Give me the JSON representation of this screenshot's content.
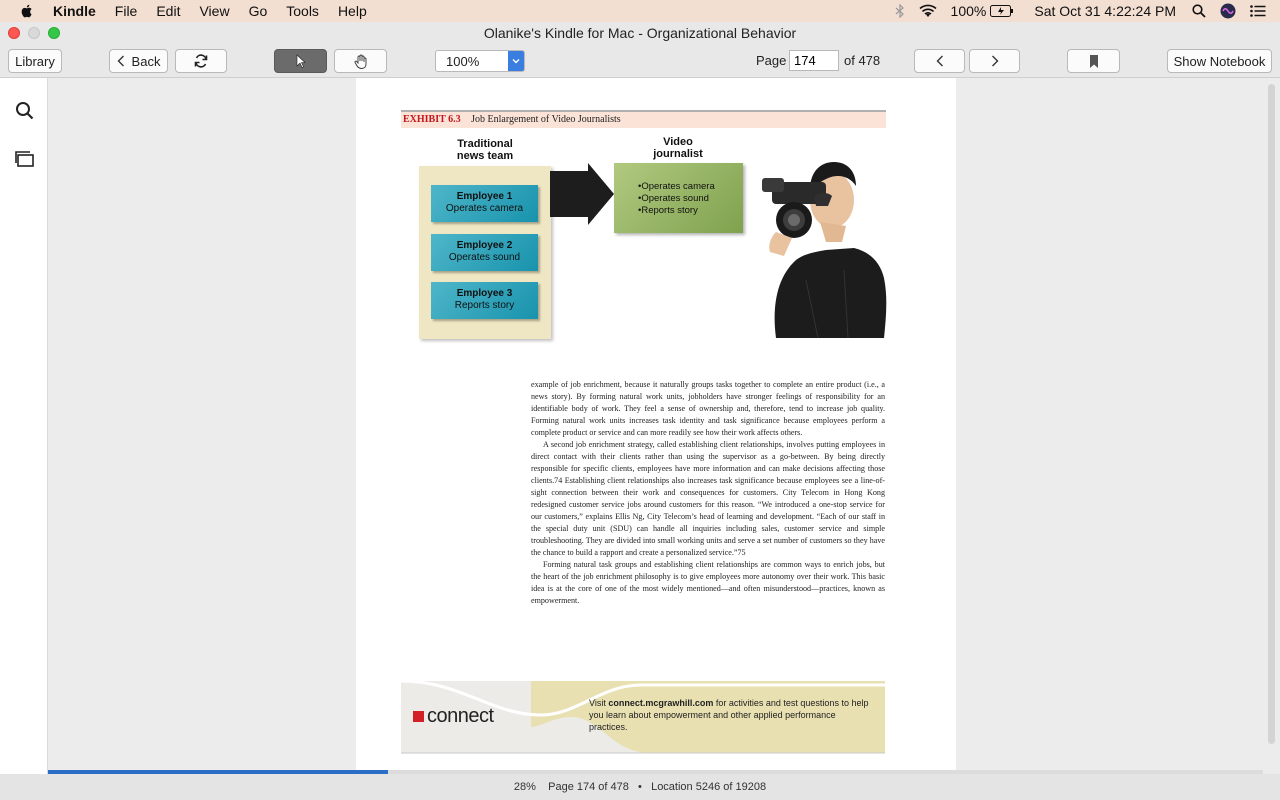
{
  "menubar": {
    "app_name": "Kindle",
    "items": [
      "File",
      "Edit",
      "View",
      "Go",
      "Tools",
      "Help"
    ],
    "battery": "100%",
    "clock": "Sat Oct 31  4:22:24 PM"
  },
  "window": {
    "title": "Olanike's Kindle for Mac - Organizational Behavior"
  },
  "toolbar": {
    "library_label": "Library",
    "back_label": "Back",
    "zoom_value": "100%",
    "page_label": "Page",
    "page_input": "174",
    "page_total": "of 478",
    "notebook_label": "Show Notebook"
  },
  "exhibit": {
    "number": "EXHIBIT 6.3",
    "title": "Job Enlargement of Video Journalists",
    "left_heading": "Traditional news team",
    "right_heading": "Video journalist",
    "employees": [
      {
        "name": "Employee 1",
        "task": "Operates camera"
      },
      {
        "name": "Employee 2",
        "task": "Operates sound"
      },
      {
        "name": "Employee 3",
        "task": "Reports story"
      }
    ],
    "journalist_tasks": [
      "Operates camera",
      "Operates sound",
      "Reports story"
    ]
  },
  "body": {
    "p1": "example of job enrichment, because it naturally groups tasks together to complete an entire product (i.e., a news story). By forming natural work units, jobholders have stronger feelings of responsibility for an identifiable body of work. They feel a sense of ownership and, therefore, tend to increase job quality. Forming natural work units increases task identity and task significance because employees perform a complete product or service and can more readily see how their work affects others.",
    "p2": "A second job enrichment strategy, called establishing client relationships, involves putting employees in direct contact with their clients rather than using the supervisor as a go-between. By being directly responsible for specific clients, employees have more information and can make decisions affecting those clients.74 Establishing client relationships also increases task significance because employees see a line-of-sight connection between their work and consequences for customers. City Telecom in Hong Kong redesigned customer service jobs around customers for this reason. “We introduced a one-stop service for our customers,” explains Ellis Ng, City Telecom’s head of learning and development. “Each of our staff in the special duty unit (SDU) can handle all inquiries including sales, customer service and simple troubleshooting. They are divided into small working units and serve a set number of customers so they have the chance to build a rapport and create a personalized service.”75",
    "p3": "Forming natural task groups and establishing client relationships are common ways to enrich jobs, but the heart of the job enrichment philosophy is to give employees more autonomy over their work. This basic idea is at the core of one of the most widely mentioned—and often misunderstood—practices, known as empowerment."
  },
  "banner": {
    "logo_text": "connect",
    "text_prefix": "Visit ",
    "url": "connect.mcgrawhill.com",
    "text_suffix": " for activities and test questions to help you learn about empowerment and other applied performance practices."
  },
  "status": {
    "progress_percent": 28,
    "text": "28%    Page 174 of 478   •   Location 5246 of 19208"
  },
  "colors": {
    "accent_blue": "#2b6ec8",
    "exhibit_red": "#c4161c",
    "employee_teal": "#1893ad",
    "journalist_green": "#7fa24e"
  }
}
